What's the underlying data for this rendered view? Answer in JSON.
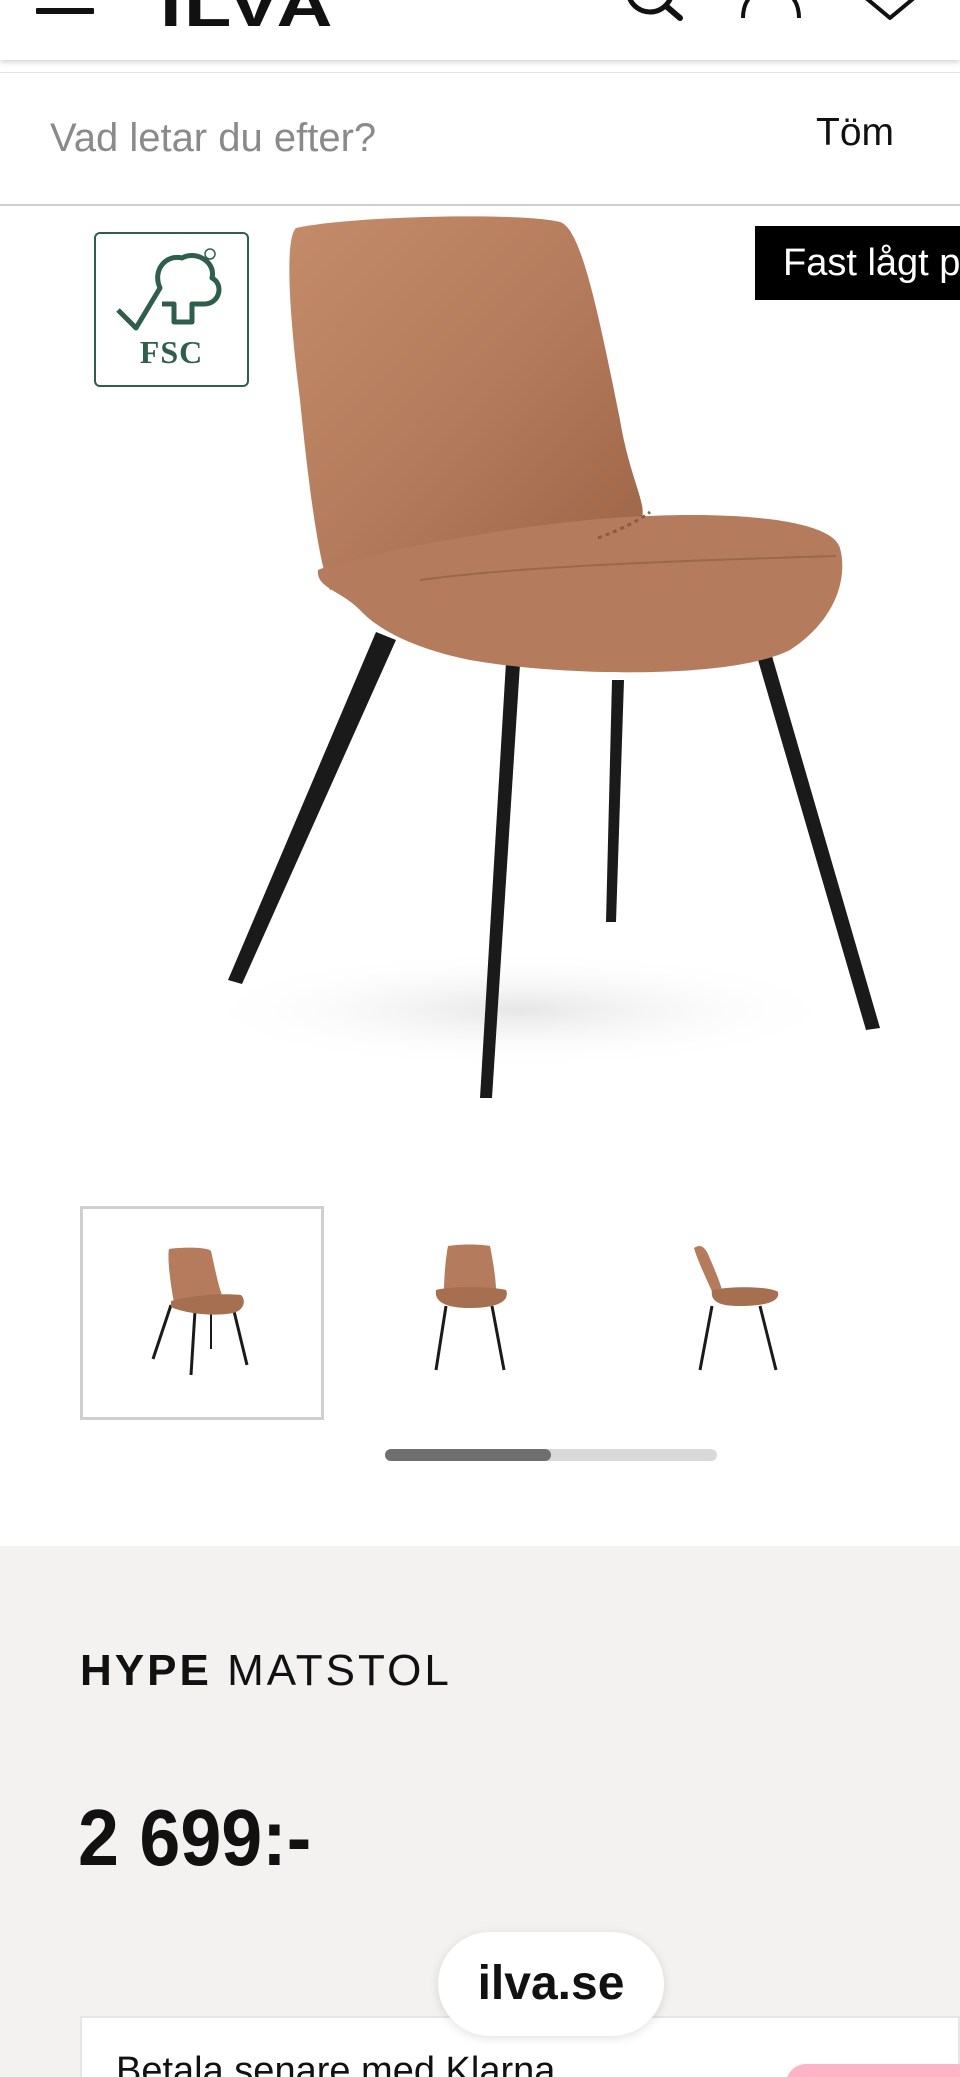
{
  "header": {
    "logo": "ILVA",
    "icons": [
      "menu-icon",
      "search-icon",
      "account-icon",
      "heart-icon"
    ]
  },
  "search": {
    "placeholder": "Vad letar du efter?",
    "value": "",
    "clear_label": "Töm"
  },
  "gallery": {
    "badge_text": "FSC",
    "ribbon_text": "Fast lågt pr",
    "thumbnails": [
      "chair-front-angle",
      "chair-front",
      "chair-side"
    ],
    "selected_index": 0,
    "scroll_progress": 0.5
  },
  "product": {
    "brand": "HYPE",
    "type": "MATSTOL",
    "price": "2 699:-"
  },
  "klarna": {
    "text": "Betala senare med Klarna"
  },
  "browser": {
    "domain": "ilva.se"
  },
  "colors": {
    "chair_leather": "#b47c5c",
    "fsc_green": "#2f5f4b",
    "info_background": "#f3f2f1",
    "klarna_pink": "#ffb3c7"
  }
}
